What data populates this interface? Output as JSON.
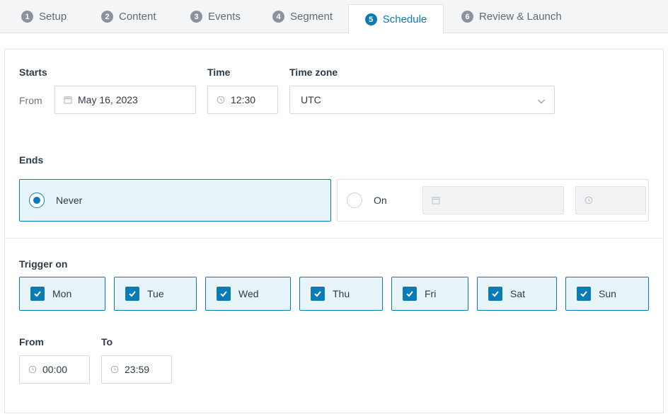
{
  "tabs": [
    {
      "num": "1",
      "label": "Setup"
    },
    {
      "num": "2",
      "label": "Content"
    },
    {
      "num": "3",
      "label": "Events"
    },
    {
      "num": "4",
      "label": "Segment"
    },
    {
      "num": "5",
      "label": "Schedule"
    },
    {
      "num": "6",
      "label": "Review & Launch"
    }
  ],
  "active_tab": "Schedule",
  "starts": {
    "label": "Starts",
    "from_label": "From",
    "date_value": "May 16, 2023",
    "time_label": "Time",
    "time_value": "12:30",
    "timezone_label": "Time zone",
    "timezone_value": "UTC"
  },
  "ends": {
    "label": "Ends",
    "never_label": "Never",
    "on_label": "On",
    "selected": "Never",
    "on_date_value": "",
    "on_time_value": ""
  },
  "trigger": {
    "label": "Trigger on",
    "days": [
      {
        "label": "Mon",
        "checked": true
      },
      {
        "label": "Tue",
        "checked": true
      },
      {
        "label": "Wed",
        "checked": true
      },
      {
        "label": "Thu",
        "checked": true
      },
      {
        "label": "Fri",
        "checked": true
      },
      {
        "label": "Sat",
        "checked": true
      },
      {
        "label": "Sun",
        "checked": true
      }
    ],
    "from_label": "From",
    "from_value": "00:00",
    "to_label": "To",
    "to_value": "23:59"
  },
  "colors": {
    "accent": "#0a7bb5",
    "selected_bg": "#e7f4fa",
    "tab_bg": "#f3f5f7"
  }
}
